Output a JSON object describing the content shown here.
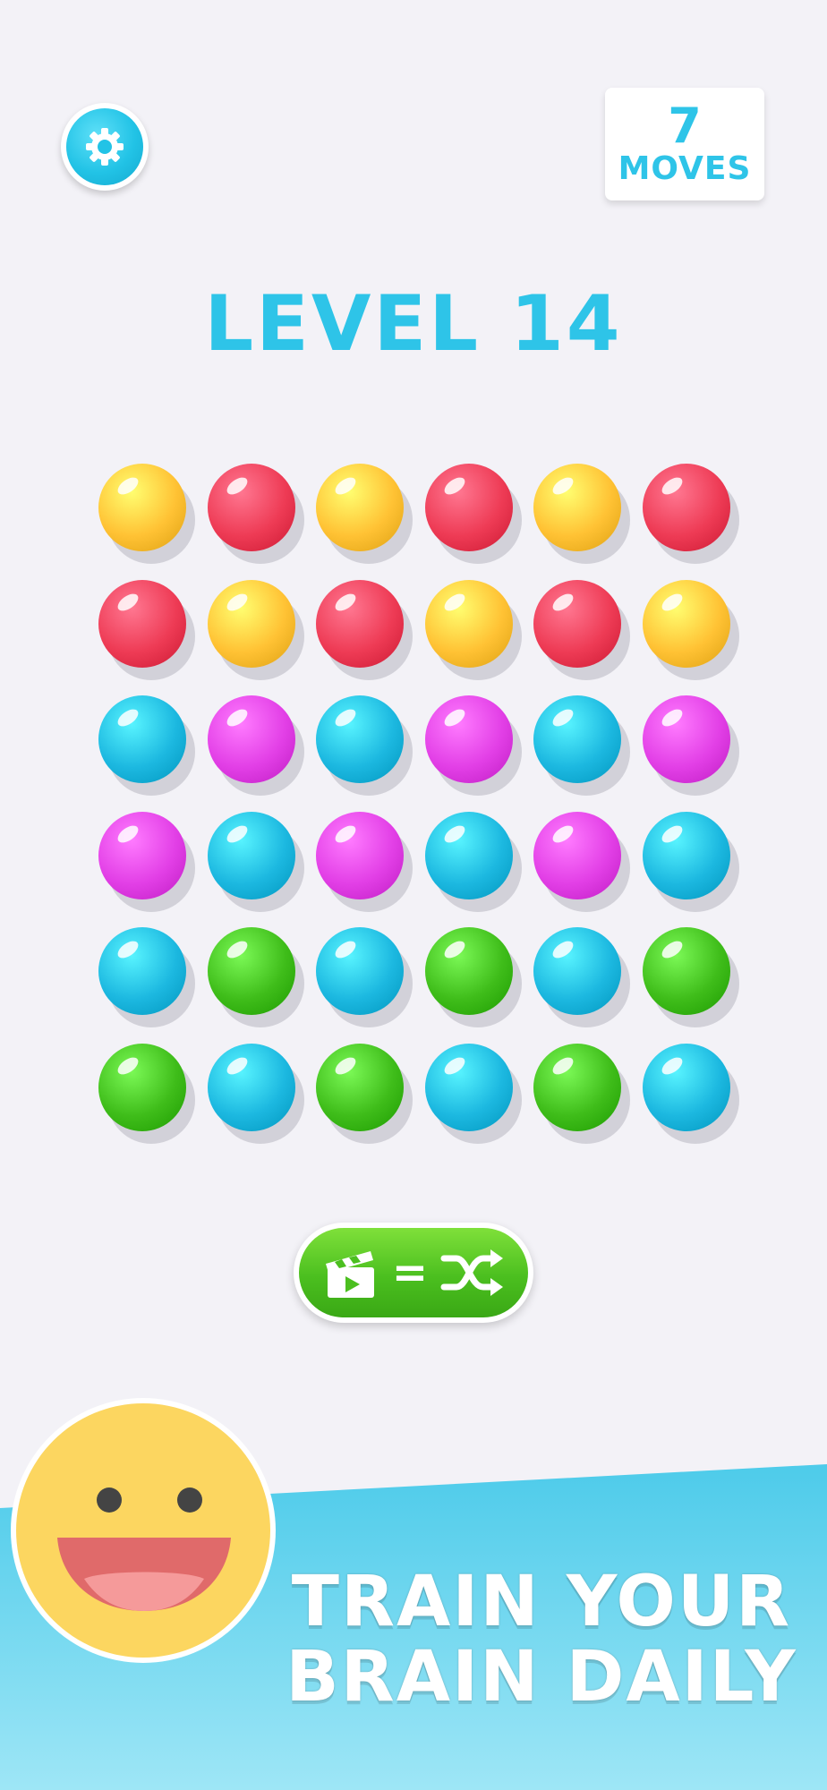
{
  "header": {
    "settings_icon": "gear-icon",
    "moves_count": "7",
    "moves_label": "MOVES"
  },
  "level": {
    "title": "LEVEL 14"
  },
  "board": {
    "rows": 6,
    "cols": 6,
    "colors": {
      "yellow": "#ffc234",
      "red": "#ee3b55",
      "blue": "#1cb8e0",
      "magenta": "#e23fe6",
      "green": "#3fbd1a"
    },
    "grid": [
      [
        "yellow",
        "red",
        "yellow",
        "red",
        "yellow",
        "red"
      ],
      [
        "red",
        "yellow",
        "red",
        "yellow",
        "red",
        "yellow"
      ],
      [
        "blue",
        "magenta",
        "blue",
        "magenta",
        "blue",
        "magenta"
      ],
      [
        "magenta",
        "blue",
        "magenta",
        "blue",
        "magenta",
        "blue"
      ],
      [
        "blue",
        "green",
        "blue",
        "green",
        "blue",
        "green"
      ],
      [
        "green",
        "blue",
        "green",
        "blue",
        "green",
        "blue"
      ]
    ]
  },
  "shuffle_button": {
    "icon_left": "video-clapper-icon",
    "symbol": "=",
    "icon_right": "shuffle-icon",
    "color": "#4bbf1f"
  },
  "promo": {
    "smiley_icon": "smiley-face-icon",
    "line1": "TRAIN YOUR",
    "line2": "BRAIN DAILY",
    "band_color": "#4dcbea"
  }
}
